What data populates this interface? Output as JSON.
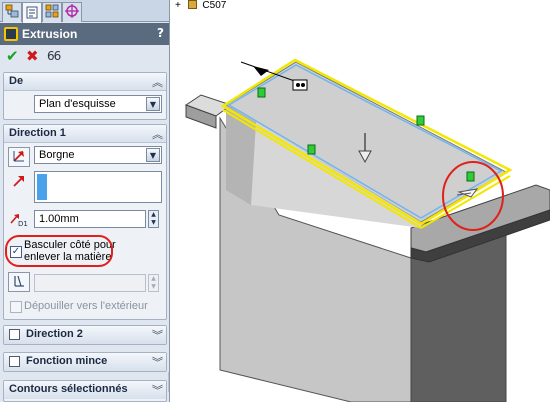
{
  "tabs": [
    {
      "name": "feature-manager",
      "icon": "feature-manager-icon"
    },
    {
      "name": "property-manager",
      "icon": "property-manager-icon"
    },
    {
      "name": "configuration-manager",
      "icon": "configuration-manager-icon"
    },
    {
      "name": "dimxpert",
      "icon": "crosshair-icon"
    }
  ],
  "title": {
    "label": "Extrusion",
    "help": "?"
  },
  "actions": {
    "ok": "✔",
    "cancel": "✖",
    "detail": "66"
  },
  "groups": {
    "de": {
      "label": "De",
      "select_value": "Plan d'esquisse"
    },
    "direction1": {
      "label": "Direction 1",
      "end_condition": "Borgne",
      "depth_value": "1.00mm",
      "depth_prefix": "D1",
      "flip_side_label_line1": "Basculer côté pour",
      "flip_side_label_line2": "enlever la matière",
      "flip_side_checked": true,
      "draft_outward_label": "Dépouiller vers l'extérieur"
    },
    "direction2": {
      "label": "Direction 2"
    },
    "thin_feature": {
      "label": "Fonction mince"
    },
    "selected_contours": {
      "label": "Contours sélectionnés"
    }
  },
  "viewport": {
    "tree_item": "C507"
  },
  "colors": {
    "accent_red": "#e0201a",
    "panel_bg": "#dfe6ef",
    "title_bg": "#5a6b80",
    "model_dark": "#8a8a8a",
    "model_light": "#c6c6c6",
    "edge_yellow": "#f2e700",
    "edge_blue": "#6fb6f0"
  }
}
